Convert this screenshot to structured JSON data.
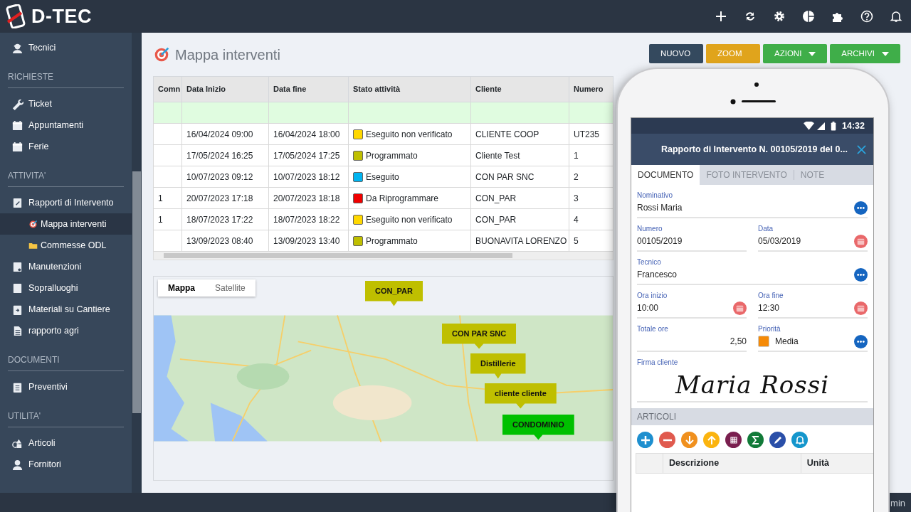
{
  "app": {
    "title": "D-TEC"
  },
  "sidebar": {
    "groups": [
      {
        "items": [
          {
            "label": "Tecnici",
            "selected": false
          }
        ]
      },
      {
        "heading": "RICHIESTE",
        "items": [
          {
            "label": "Ticket",
            "selected": false
          },
          {
            "label": "Appuntamenti",
            "selected": false
          },
          {
            "label": "Ferie",
            "selected": false
          }
        ]
      },
      {
        "heading": "ATTIVITA'",
        "items": [
          {
            "label": "Rapporti di Intervento",
            "selected": false,
            "children": [
              {
                "label": "Mappa interventi",
                "selected": true
              },
              {
                "label": "Commesse ODL",
                "selected": false
              }
            ]
          },
          {
            "label": "Manutenzioni",
            "selected": false
          },
          {
            "label": "Sopralluoghi",
            "selected": false
          },
          {
            "label": "Materiali su Cantiere",
            "selected": false
          },
          {
            "label": "rapporto agri",
            "selected": false
          }
        ]
      },
      {
        "heading": "DOCUMENTI",
        "items": [
          {
            "label": "Preventivi",
            "selected": false
          }
        ]
      },
      {
        "heading": "UTILITA'",
        "items": [
          {
            "label": "Articoli",
            "selected": false
          },
          {
            "label": "Fornitori",
            "selected": false
          }
        ]
      }
    ]
  },
  "page": {
    "title": "Mappa interventi"
  },
  "toolbar": [
    {
      "label": "NUOVO",
      "color": "#34495e",
      "dropdown": false
    },
    {
      "label": "ZOOM",
      "color": "#e0a41c",
      "dropdown": false
    },
    {
      "label": "AZIONI",
      "color": "#3fae49",
      "dropdown": true
    },
    {
      "label": "ARCHIVI",
      "color": "#3fae49",
      "dropdown": true
    }
  ],
  "table": {
    "columns": [
      "Comn",
      "Data Inizio",
      "Data fine",
      "Stato attività",
      "Cliente",
      "Numero"
    ],
    "rows": [
      {
        "start": "16/04/2024 09:00",
        "end": "16/04/2024 18:00",
        "status": "Eseguito non verificato",
        "color": "#ffd800",
        "client": "CLIENTE COOP",
        "number": "UT235"
      },
      {
        "start": "17/05/2024 16:25",
        "end": "17/05/2024 17:25",
        "status": "Programmato",
        "color": "#bfbf00",
        "client": "Cliente Test",
        "number": "1"
      },
      {
        "start": "10/07/2023 09:12",
        "end": "10/07/2023 18:12",
        "status": "Eseguito",
        "color": "#00b4f0",
        "client": "CON PAR SNC",
        "number": "2"
      },
      {
        "comm": "1",
        "start": "20/07/2023 17:18",
        "end": "20/07/2023 18:18",
        "status": "Da Riprogrammare",
        "color": "#f00000",
        "client": "CON_PAR",
        "number": "3"
      },
      {
        "comm": "1",
        "start": "18/07/2023 17:22",
        "end": "18/07/2023 18:22",
        "status": "Eseguito non verificato",
        "color": "#ffd800",
        "client": "CON_PAR",
        "number": "4"
      },
      {
        "start": "13/09/2023 08:40",
        "end": "13/09/2023 13:40",
        "status": "Programmato",
        "color": "#bfbf00",
        "client": "BUONAVITA LORENZO",
        "number": "5"
      }
    ]
  },
  "map": {
    "tabs": [
      {
        "label": "Mappa",
        "selected": true
      },
      {
        "label": "Satellite",
        "selected": false
      }
    ],
    "markers": [
      {
        "label": "CON_PAR",
        "color": "#bfbf00"
      },
      {
        "label": "CON PAR SNC",
        "color": "#bfbf00"
      },
      {
        "label": "Distillerie",
        "color": "#bfbf00"
      },
      {
        "label": "cliente cliente",
        "color": "#bfbf00"
      },
      {
        "label": "CONDOMINIO",
        "color": "#00c000"
      }
    ]
  },
  "status_bar": {
    "user": "min"
  },
  "phone": {
    "time": "14:32",
    "title": "Rapporto di Intervento N. 00105/2019 del 0...",
    "tabs": [
      {
        "label": "DOCUMENTO",
        "selected": true
      },
      {
        "label": "FOTO INTERVENTO",
        "selected": false
      },
      {
        "label": "NOTE",
        "selected": false
      }
    ],
    "form_lines": [
      {
        "fields": [
          {
            "kind": "lookup",
            "label": "Nominativo",
            "value": "Rossi Maria"
          }
        ]
      },
      {
        "fields": [
          {
            "kind": "text",
            "label": "Numero",
            "value": "00105/2019"
          },
          {
            "kind": "date",
            "label": "Data",
            "value": "05/03/2019"
          }
        ]
      },
      {
        "fields": [
          {
            "kind": "lookup",
            "label": "Tecnico",
            "value": "Francesco"
          }
        ]
      },
      {
        "fields": [
          {
            "kind": "date",
            "label": "Ora inizio",
            "value": "10:00"
          },
          {
            "kind": "date",
            "label": "Ora fine",
            "value": "12:30"
          }
        ]
      },
      {
        "fields": [
          {
            "kind": "number",
            "label": "Totale ore",
            "value": "2,50"
          },
          {
            "kind": "priority",
            "label": "Priorità",
            "value": "Media",
            "color": "#f58a07"
          }
        ]
      }
    ],
    "signature": {
      "label": "Firma cliente",
      "value": "Maria Rossi"
    },
    "section": "ARTICOLI",
    "actions": [
      {
        "color": "#1e8fcf"
      },
      {
        "color": "#e05a4e"
      },
      {
        "color": "#f0901e"
      },
      {
        "color": "#fbb40f"
      },
      {
        "color": "#7a1f4f"
      },
      {
        "color": "#117a38"
      },
      {
        "color": "#2a4fa8"
      },
      {
        "color": "#1496cc"
      }
    ],
    "columns": [
      "Descrizione",
      "Unità"
    ]
  }
}
